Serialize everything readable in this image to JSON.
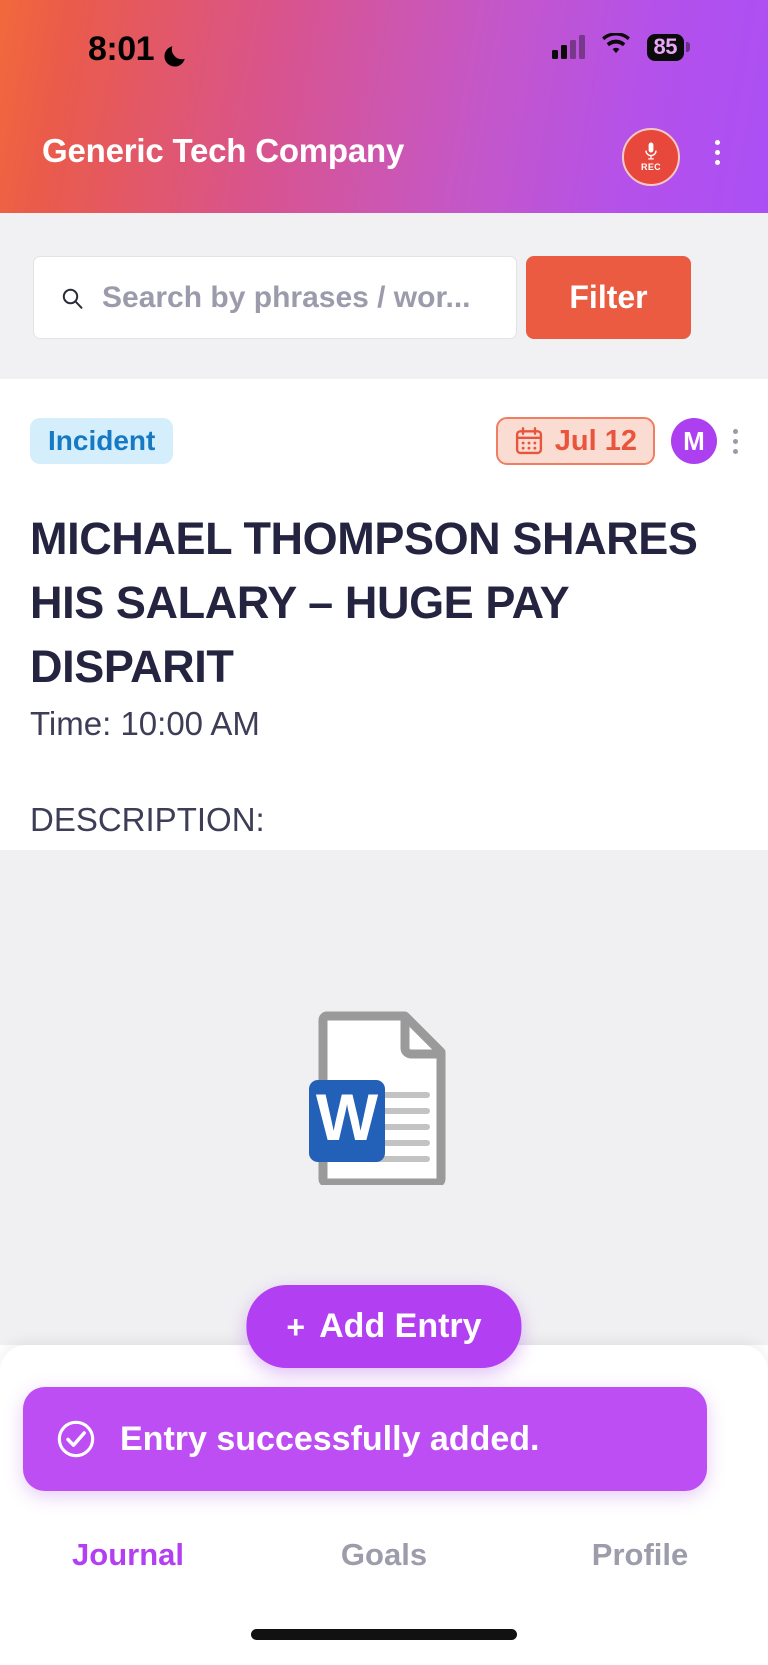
{
  "statusbar": {
    "time": "8:01",
    "moon_icon": "crescent-moon-icon",
    "signal_icon": "cellular-signal-icon",
    "wifi_icon": "wifi-icon",
    "battery_level": "85"
  },
  "header": {
    "app_title": "Generic Tech Company",
    "record_button": {
      "icon": "microphone-icon",
      "label": "REC"
    },
    "overflow_menu": "kebab-menu-icon",
    "gradient_start": "#f2693c",
    "gradient_end": "#ab4ff5"
  },
  "search": {
    "placeholder": "Search by phrases / wor...",
    "value": "",
    "icon": "search-icon",
    "filter_label": "Filter",
    "filter_color": "#ea5b42"
  },
  "entry": {
    "category_badge": "Incident",
    "badge_bg": "#d4eefb",
    "badge_color": "#1579c4",
    "date": "Jul 12",
    "date_icon": "calendar-icon",
    "date_color": "#e8553c",
    "avatar_initial": "M",
    "avatar_color": "#ac3ff0",
    "overflow_menu": "kebab-menu-icon",
    "title": "MICHAEL THOMPSON SHARES HIS SALARY – HUGE PAY DISPARIT",
    "time": "Time: 10:00 AM",
    "description_label": "DESCRIPTION:",
    "attachment": {
      "type": "word-document",
      "icon": "word-document-icon",
      "badge_letter": "W",
      "badge_color": "#2360b8"
    }
  },
  "bottom": {
    "add_entry_label": "Add Entry",
    "add_entry_plus": "+",
    "add_entry_color": "#b33ff2",
    "tabs": [
      {
        "label": "Journal",
        "active": true
      },
      {
        "label": "Goals",
        "active": false
      },
      {
        "label": "Profile",
        "active": false
      }
    ]
  },
  "toast": {
    "message": "Entry successfully added.",
    "icon": "check-circle-icon",
    "background": "#bc4ef3"
  }
}
